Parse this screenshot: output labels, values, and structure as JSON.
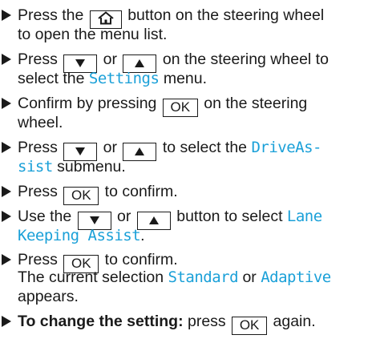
{
  "steps": [
    {
      "lines": [
        {
          "t1": "Press the ",
          "t2": " button on the steering wheel"
        },
        {
          "t1": "to open the menu list."
        }
      ]
    },
    {
      "lines": [
        {
          "t1": "Press ",
          "t2": " or ",
          "t3": " on the steering wheel to"
        },
        {
          "t1": "select the ",
          "d1": "Settings",
          "t2": " menu."
        }
      ]
    },
    {
      "lines": [
        {
          "t1": "Confirm by pressing ",
          "k1": "OK",
          "t2": " on the steering"
        },
        {
          "t1": "wheel."
        }
      ]
    },
    {
      "lines": [
        {
          "t1": "Press ",
          "t2": " or ",
          "t3": " to select the ",
          "d1": "DriveAs-"
        },
        {
          "d1": "sist",
          "t1": " submenu."
        }
      ]
    },
    {
      "lines": [
        {
          "t1": "Press ",
          "k1": "OK",
          "t2": " to confirm."
        }
      ]
    },
    {
      "lines": [
        {
          "t1": "Use the ",
          "t2": " or ",
          "t3": " button to select ",
          "d1": "Lane"
        },
        {
          "d1": "Keeping Assist",
          "t1": "."
        }
      ]
    },
    {
      "lines": [
        {
          "t1": "Press ",
          "k1": "OK",
          "t2": " to confirm."
        },
        {
          "t1": "The current selection ",
          "d1": "Standard",
          "t2": " or ",
          "d2": "Adaptive"
        },
        {
          "t1": "appears."
        }
      ]
    },
    {
      "lines": [
        {
          "b1": "To change the setting:",
          "t1": " press ",
          "k1": "OK",
          "t2": " again."
        }
      ]
    }
  ],
  "icons": {
    "home": "home-icon",
    "down": "down-arrow-icon",
    "up": "up-arrow-icon",
    "bullet": "triangle-bullet-icon"
  },
  "colors": {
    "text": "#1a1a1a",
    "display_text": "#1aa0d8"
  }
}
